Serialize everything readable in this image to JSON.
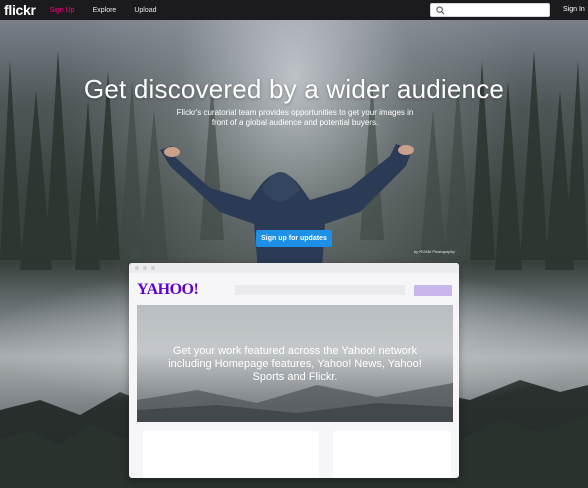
{
  "nav": {
    "logo": "flickr",
    "links": [
      "Sign Up",
      "Explore",
      "Upload"
    ],
    "search_placeholder": "",
    "sign_in": "Sign In"
  },
  "hero": {
    "headline": "Get discovered by a wider audience",
    "subtext": "Flickr's curatorial team provides opportunities to get your images in front of a global audience and potential buyers.",
    "cta": "Sign up for updates",
    "credit": "by ROMA Photography"
  },
  "card": {
    "brand": "YAHOO!",
    "banner_text": "Get your work featured across the Yahoo! network including Homepage features, Yahoo! News, Yahoo! Sports and Flickr."
  },
  "colors": {
    "nav_bg": "#1b1b1d",
    "active_link": "#ff0084",
    "cta": "#1e8fe6",
    "yahoo_purple": "#5f01d1"
  }
}
